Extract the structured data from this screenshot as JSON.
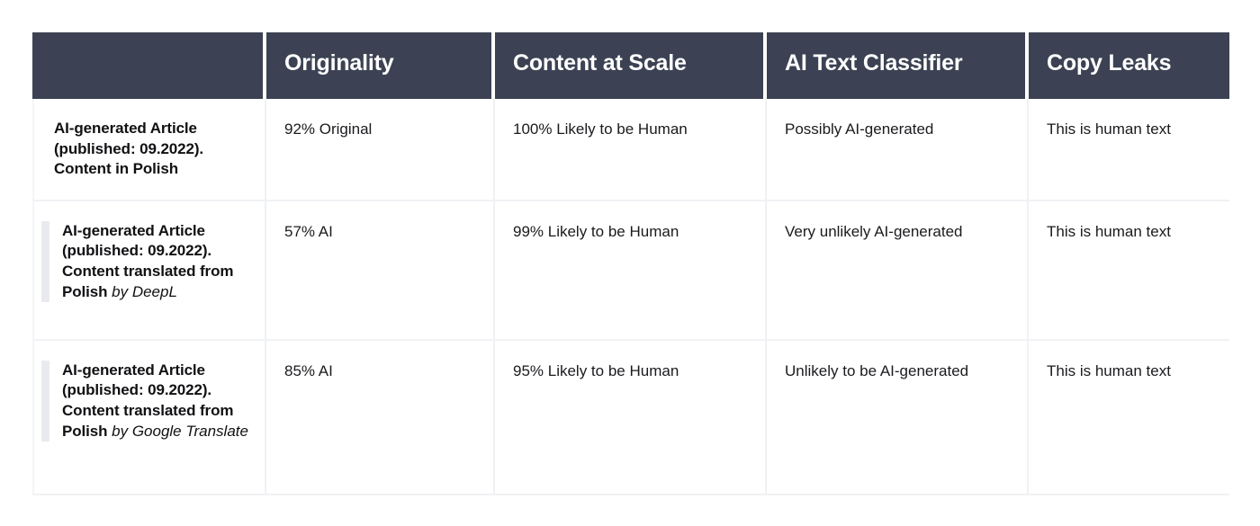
{
  "table": {
    "columns": [
      {
        "key": "label",
        "header": ""
      },
      {
        "key": "originality",
        "header": "Originality"
      },
      {
        "key": "cas",
        "header": "Content at Scale"
      },
      {
        "key": "aitc",
        "header": "AI Text Classifier"
      },
      {
        "key": "copyleaks",
        "header": "Copy Leaks"
      }
    ],
    "rows": [
      {
        "label_bold": "AI-generated Article (published: 09.2022). Content in Polish",
        "label_suffix": "",
        "has_accent_bar": false,
        "originality": "92% Original",
        "cas": "100% Likely to be Human",
        "aitc": "Possibly AI-generated",
        "copyleaks": "This is human text"
      },
      {
        "label_bold": "AI-generated Article (published: 09.2022). Content translated from Polish",
        "label_suffix": " by DeepL",
        "has_accent_bar": true,
        "originality": "57% AI",
        "cas": "99% Likely to be Human",
        "aitc": "Very unlikely AI-generated",
        "copyleaks": "This is human text"
      },
      {
        "label_bold": "AI-generated Article (published: 09.2022). Content translated from Polish",
        "label_suffix": " by Google Translate",
        "has_accent_bar": true,
        "originality": "85% AI",
        "cas": "95% Likely to be Human",
        "aitc": "Unlikely to be AI-generated",
        "copyleaks": "This is human text"
      }
    ]
  },
  "colors": {
    "header_background": "#3c4253",
    "header_text": "#ffffff",
    "body_text": "#1b1b1f",
    "grid_line": "#f0f1f4",
    "accent_bar": "#e8eaef",
    "page_background": "#ffffff"
  }
}
